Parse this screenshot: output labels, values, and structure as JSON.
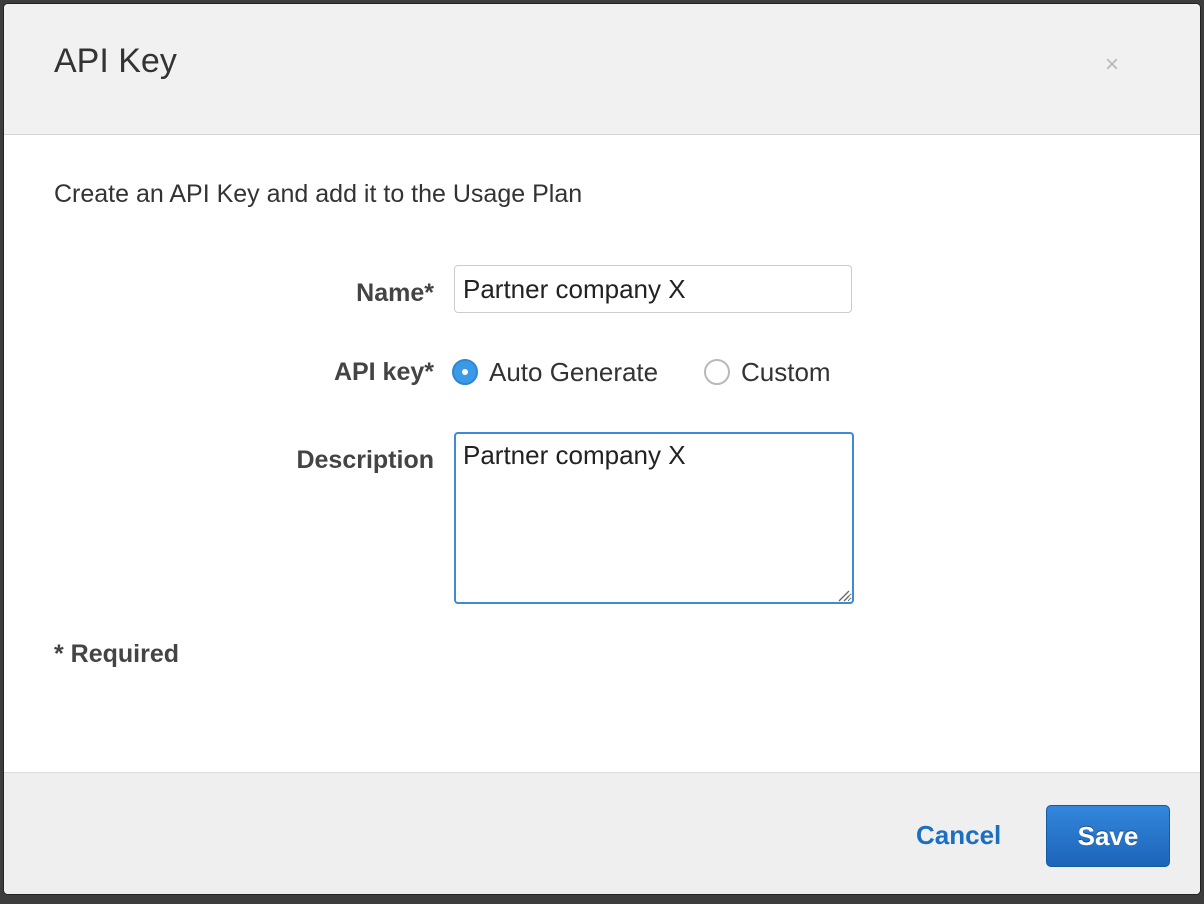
{
  "dialog": {
    "title": "API Key",
    "close_label": "×"
  },
  "intro": "Create an API Key and add it to the Usage Plan",
  "form": {
    "name_label": "Name*",
    "name_value": "Partner company X",
    "api_key_label": "API key*",
    "api_key_options": [
      {
        "label": "Auto Generate",
        "selected": true
      },
      {
        "label": "Custom",
        "selected": false
      }
    ],
    "description_label": "Description",
    "description_value": "Partner company X",
    "required_note": "* Required"
  },
  "footer": {
    "cancel_label": "Cancel",
    "save_label": "Save"
  },
  "colors": {
    "accent": "#3a9ae8",
    "link": "#1c6fc0",
    "save_button": "#1c64b8"
  }
}
